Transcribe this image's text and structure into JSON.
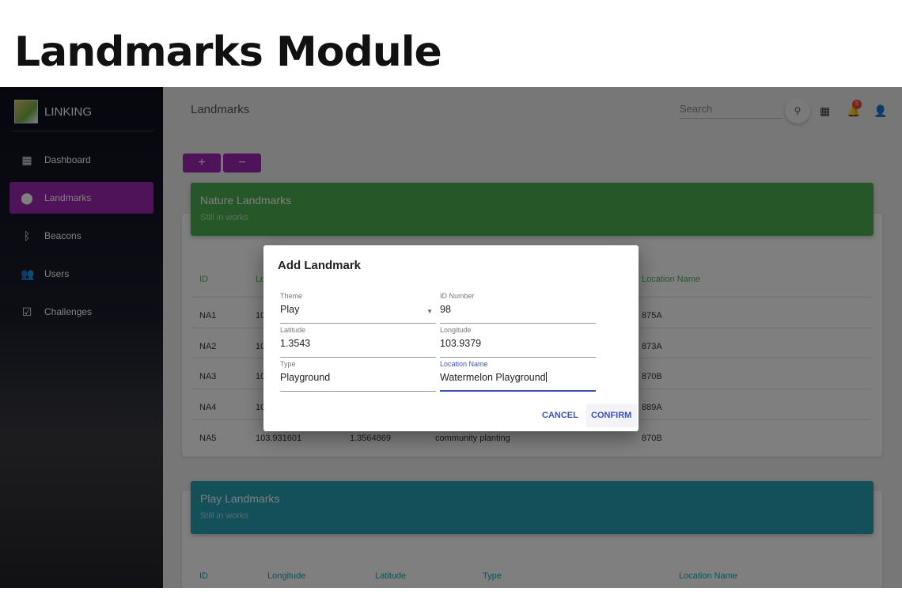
{
  "slide_title": "Landmarks Module",
  "app": {
    "brand": "LINKING",
    "nav": [
      {
        "label": "Dashboard",
        "icon": "dashboard-icon"
      },
      {
        "label": "Landmarks",
        "icon": "location-pin-icon",
        "active": true
      },
      {
        "label": "Beacons",
        "icon": "bluetooth-icon"
      },
      {
        "label": "Users",
        "icon": "users-icon"
      },
      {
        "label": "Challenges",
        "icon": "clipboard-check-icon"
      }
    ],
    "header": {
      "title": "Landmarks",
      "search_placeholder": "Search",
      "notification_count": "5"
    },
    "actions": {
      "add": "+",
      "remove": "−"
    },
    "nature": {
      "title": "Nature Landmarks",
      "subtitle": "Still in works",
      "color": "#4caf50",
      "columns": [
        "ID",
        "Lo",
        "Location Name"
      ],
      "rows": [
        {
          "id": "NA1",
          "lon": "10",
          "lat": "",
          "type": "",
          "loc": "875A"
        },
        {
          "id": "NA2",
          "lon": "10",
          "lat": "",
          "type": "",
          "loc": "873A"
        },
        {
          "id": "NA3",
          "lon": "10",
          "lat": "",
          "type": "",
          "loc": "870B"
        },
        {
          "id": "NA4",
          "lon": "10",
          "lat": "",
          "type": "",
          "loc": "889A"
        },
        {
          "id": "NA5",
          "lon": "103.931601",
          "lat": "1.3564869",
          "type": "community planting",
          "loc": "870B"
        }
      ]
    },
    "play": {
      "title": "Play Landmarks",
      "subtitle": "Still in works",
      "color": "#26a0b2",
      "columns": [
        "ID",
        "Longitude",
        "Latitude",
        "Type",
        "Location Name"
      ]
    }
  },
  "modal": {
    "title": "Add Landmark",
    "fields": {
      "theme": {
        "label": "Theme",
        "value": "Play"
      },
      "id_number": {
        "label": "ID Number",
        "value": "98"
      },
      "latitude": {
        "label": "Latitude",
        "value": "1.3543"
      },
      "longitude": {
        "label": "Longitude",
        "value": "103.9379"
      },
      "type": {
        "label": "Type",
        "value": "Playground"
      },
      "location_name": {
        "label": "Location Name",
        "value": "Watermelon Playground"
      }
    },
    "cancel": "CANCEL",
    "confirm": "CONFIRM",
    "accent": "#3f51b5"
  }
}
